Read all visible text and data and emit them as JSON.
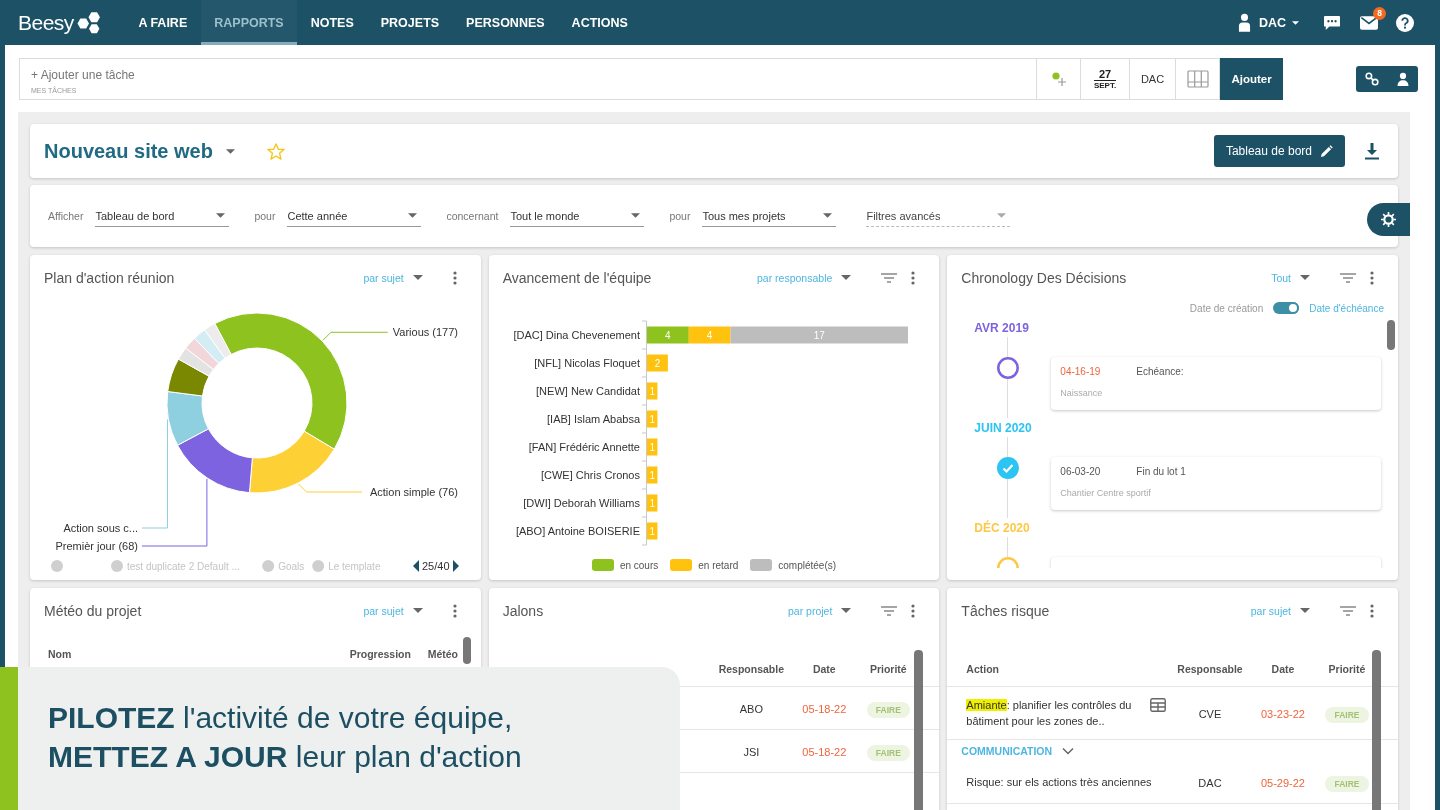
{
  "top_bar": {
    "logo": "Beesy",
    "nav": [
      {
        "label": "A FAIRE",
        "selected": false
      },
      {
        "label": "RAPPORTS",
        "selected": true
      },
      {
        "label": "NOTES",
        "selected": false
      },
      {
        "label": "PROJETS",
        "selected": false
      },
      {
        "label": "PERSONNES",
        "selected": false
      },
      {
        "label": "ACTIONS",
        "selected": false
      }
    ],
    "user": "DAC",
    "mail_badge": "8"
  },
  "task_bar": {
    "placeholder": "+ Ajouter une tâche",
    "caption": "MES TÂCHES",
    "date": {
      "day": "27",
      "month": "SEPT."
    },
    "assignee": "DAC",
    "add_button": "Ajouter"
  },
  "project": {
    "title": "Nouveau site web",
    "starred": false,
    "dashboard_button": "Tableau de bord"
  },
  "filters": [
    {
      "kind": "select",
      "label": "Afficher",
      "value": "Tableau de bord"
    },
    {
      "kind": "select",
      "label": "pour",
      "value": "Cette année"
    },
    {
      "kind": "select",
      "label": "concernant",
      "value": "Tout le monde"
    },
    {
      "kind": "select",
      "label": "pour",
      "value": "Tous mes projets"
    },
    {
      "kind": "advanced",
      "value": "Filtres avancés"
    }
  ],
  "widgets": [
    {
      "kind": "donut",
      "title": "Plan d'action réunion",
      "grouping": "par sujet",
      "filter_icon": false,
      "chart_data": {
        "type": "donut",
        "categories": [
          "Various (177)",
          "Action simple (76)",
          "Premièr jour (68)",
          "Action sous c...",
          null,
          null,
          null,
          null,
          null
        ],
        "values": [
          177,
          76,
          68,
          42,
          26,
          10,
          10,
          10,
          9
        ],
        "colors": [
          "#8dc21f",
          "#fdd035",
          "#7e63e0",
          "#8ecfe0",
          "#7a8700",
          "#e3e3e3",
          "#f2d7da",
          "#d4edf4",
          "#ececec"
        ]
      },
      "legend": [
        {
          "hidden": true
        },
        {
          "label": "test duplicate 2 Default ...",
          "hidden": true
        },
        {
          "label": "Goals",
          "hidden": true
        },
        {
          "label": "Le template",
          "hidden": true
        }
      ],
      "legend_page": "25/40"
    },
    {
      "kind": "bar",
      "title": "Avancement de l'équipe",
      "grouping": "par responsable",
      "filter_icon": true,
      "chart_data": {
        "type": "bar",
        "orientation": "horizontal",
        "stacked": true,
        "data_labels": true,
        "categories": [
          "[DAC] Dina Chevenement",
          "[NFL] Nicolas Floquet",
          "[NEW] New Candidat",
          "[IAB] Islam Ababsa",
          "[FAN] Frédéric Annette",
          "[CWE] Chris Cronos",
          "[DWI] Deborah Williams",
          "[ABO] Antoine BOISERIE"
        ],
        "series": [
          {
            "name": "en cours",
            "color": "#8dc21f",
            "values": [
              4,
              null,
              null,
              null,
              null,
              null,
              null,
              null
            ]
          },
          {
            "name": "en retard",
            "color": "#ffc20e",
            "values": [
              4,
              2,
              1,
              1,
              1,
              1,
              1,
              1
            ]
          },
          {
            "name": "complétée(s)",
            "color": "#bdbdbd",
            "values": [
              17,
              null,
              null,
              null,
              null,
              null,
              null,
              null
            ]
          }
        ]
      }
    },
    {
      "kind": "timeline",
      "title": "Chronology Des Décisions",
      "grouping": "Tout",
      "filter_icon": true,
      "toggle": {
        "off_label": "Date de création",
        "on_label": "Date d'échéance",
        "on": true
      },
      "months": [
        {
          "month": "AVR 2019",
          "color": "#7e63e0",
          "events": [
            {
              "date": "04-16-19",
              "overdue": true,
              "title": "Echéance:",
              "subtitle": "Naissance",
              "done": false
            }
          ]
        },
        {
          "month": "JUIN 2020",
          "color": "#2bc4f3",
          "events": [
            {
              "date": "06-03-20",
              "overdue": false,
              "title": "Fin du lot 1",
              "subtitle": "Chantier Centre sportif",
              "done": true
            }
          ]
        },
        {
          "month": "DÉC 2020",
          "color": "#fdc844",
          "events": [
            {
              "done": false
            }
          ]
        }
      ]
    },
    {
      "kind": "weather_table",
      "title": "Météo du projet",
      "grouping": "par sujet",
      "filter_icon": false,
      "columns": {
        "name": "Nom",
        "progress": "Progression",
        "weather": "Météo"
      }
    },
    {
      "kind": "task_table",
      "title": "Jalons",
      "grouping": "par projet",
      "filter_icon": true,
      "columns": {
        "owner": "Responsable",
        "date": "Date",
        "priority": "Priorité"
      },
      "rows": [
        {
          "kind": "task",
          "owner": "ABO",
          "date": "05-18-22",
          "overdue": true,
          "priority": "FAIRE"
        },
        {
          "kind": "task",
          "owner": "JSI",
          "date": "05-18-22",
          "overdue": true,
          "priority": "FAIRE"
        }
      ]
    },
    {
      "kind": "task_table",
      "title": "Tâches risque",
      "grouping": "par sujet",
      "filter_icon": true,
      "columns": {
        "action": "Action",
        "owner": "Responsable",
        "date": "Date",
        "priority": "Priorité"
      },
      "rows": [
        {
          "kind": "task",
          "tag": "Amiante",
          "action": ": planifier les contrôles du bâtiment pour les zones de..",
          "linked_table": true,
          "owner": "CVE",
          "date": "03-23-22",
          "overdue": true,
          "priority": "FAIRE"
        },
        {
          "kind": "group",
          "label": "COMMUNICATION",
          "expanded": true
        },
        {
          "kind": "task",
          "action": "Risque: sur els actions très anciennes",
          "linked_table": false,
          "owner": "DAC",
          "date": "05-29-22",
          "overdue": true,
          "priority": "FAIRE"
        }
      ]
    }
  ],
  "promo_banner": {
    "lines": [
      "**PILOTEZ** l'activité de votre équipe,",
      "**METTEZ A JOUR** leur plan d'action"
    ]
  }
}
